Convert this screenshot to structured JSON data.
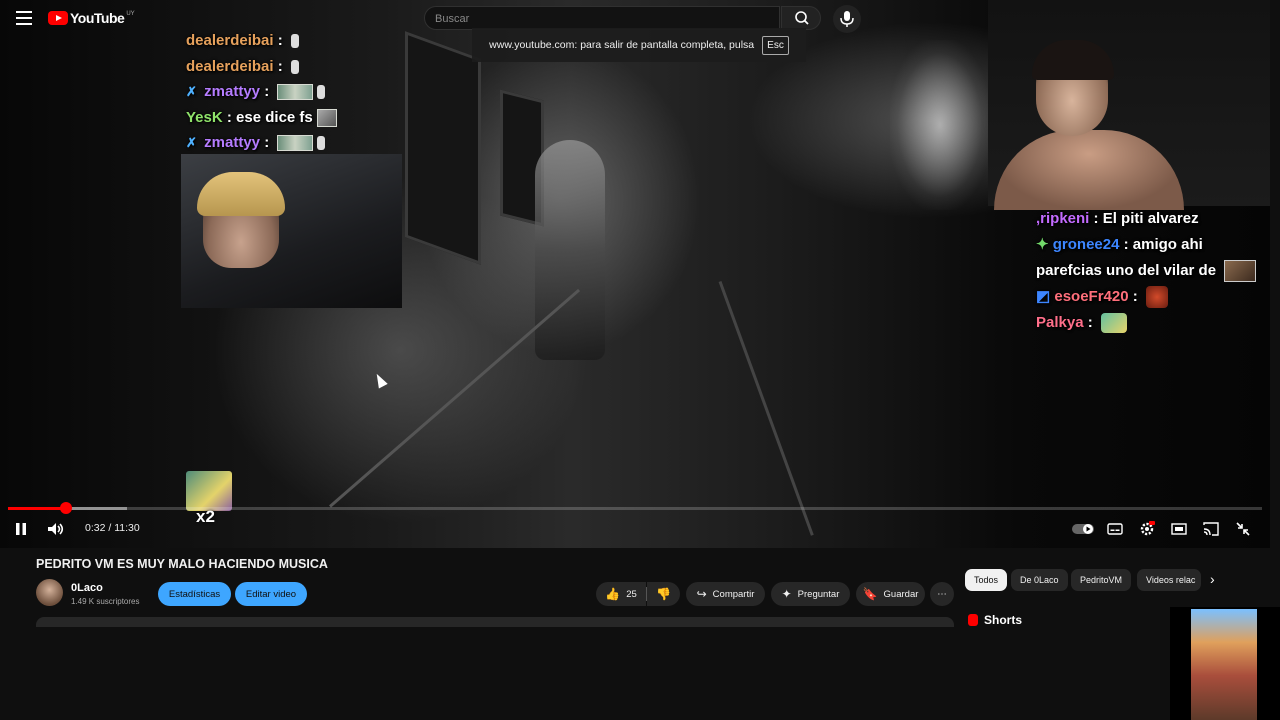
{
  "masthead": {
    "logo_text": "YouTube",
    "country_code": "UY",
    "search_placeholder": "Buscar"
  },
  "fullscreen_toast": {
    "message": "www.youtube.com: para salir de pantalla completa, pulsa",
    "key": "Esc"
  },
  "chat_left": [
    {
      "user": "dealerdeibai",
      "color": "#e6a15c",
      "badge": "",
      "text": ""
    },
    {
      "user": "dealerdeibai",
      "color": "#e6a15c",
      "badge": "",
      "text": ""
    },
    {
      "user": "zmattyy",
      "color": "#b57cff",
      "badge": "sword-icon",
      "text": ""
    },
    {
      "user": "YesK",
      "color": "#8fe36a",
      "badge": "",
      "text": "ese dice fs"
    },
    {
      "user": "zmattyy",
      "color": "#b57cff",
      "badge": "sword-icon",
      "text": ""
    }
  ],
  "chat_right": [
    {
      "user": "ripkeni",
      "color": "#c36bff",
      "prefix": ",",
      "text": "El piti alvarez"
    },
    {
      "user": "gronee24",
      "color": "#3d86ff",
      "text": "amigo ahi parefcias uno del vilar de"
    },
    {
      "user": "esoeFr420",
      "color": "#ff6f7b",
      "text": ""
    },
    {
      "user": "Palkya",
      "color": "#ff6f8a",
      "text": ""
    }
  ],
  "sticker_label": "x2",
  "player": {
    "current_time": "0:32",
    "duration": "11:30",
    "played_fraction": 0.046,
    "buffered_fraction": 0.095
  },
  "video": {
    "title": "PEDRITO VM ES MUY MALO HACIENDO MUSICA",
    "channel": "0Laco",
    "subscribers": "1.49 K suscriptores",
    "stats_button": "Estadísticas",
    "edit_button": "Editar video",
    "likes": "25",
    "share_label": "Compartir",
    "ask_label": "Preguntar",
    "save_label": "Guardar"
  },
  "chips": [
    "Todos",
    "De 0Laco",
    "PedritoVM",
    "Videos relac"
  ],
  "shorts_label": "Shorts",
  "colors": {
    "accent_red": "#ff0000",
    "button_blue": "#3ea6ff",
    "background": "#0f0f0f"
  }
}
